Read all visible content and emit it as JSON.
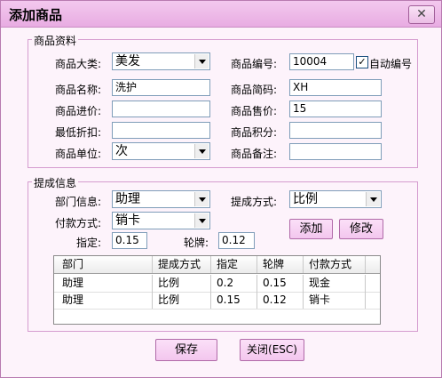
{
  "window": {
    "title": "添加商品",
    "close_glyph": "✕"
  },
  "product_group": {
    "legend": "商品资料",
    "category_label": "商品大类:",
    "category_value": "美发",
    "code_label": "商品编号:",
    "code_value": "10004",
    "auto_code_label": "自动编号",
    "auto_code_checked": true,
    "name_label": "商品名称:",
    "name_value": "洗护",
    "short_code_label": "商品简码:",
    "short_code_value": "XH",
    "cost_label": "商品进价:",
    "cost_value": "",
    "price_label": "商品售价:",
    "price_value": "15",
    "min_discount_label": "最低折扣:",
    "min_discount_value": "",
    "points_label": "商品积分:",
    "points_value": "",
    "unit_label": "商品单位:",
    "unit_value": "次",
    "remark_label": "商品备注:",
    "remark_value": ""
  },
  "commission_group": {
    "legend": "提成信息",
    "dept_label": "部门信息:",
    "dept_value": "助理",
    "method_label": "提成方式:",
    "method_value": "比例",
    "payment_label": "付款方式:",
    "payment_value": "销卡",
    "assigned_label": "指定:",
    "assigned_value": "0.15",
    "rotation_label": "轮牌:",
    "rotation_value": "0.12",
    "add_label": "添加",
    "edit_label": "修改",
    "table": {
      "headers": [
        "部门",
        "提成方式",
        "指定",
        "轮牌",
        "付款方式"
      ],
      "rows": [
        [
          "助理",
          "比例",
          "0.2",
          "0.15",
          "现金"
        ],
        [
          "助理",
          "比例",
          "0.15",
          "0.12",
          "销卡"
        ]
      ]
    }
  },
  "footer": {
    "save_label": "保存",
    "close_label": "关闭(ESC)"
  },
  "colors": {
    "title_bar": "#e8ace2",
    "button": "#f3c6ee",
    "border": "#d59ccf"
  }
}
